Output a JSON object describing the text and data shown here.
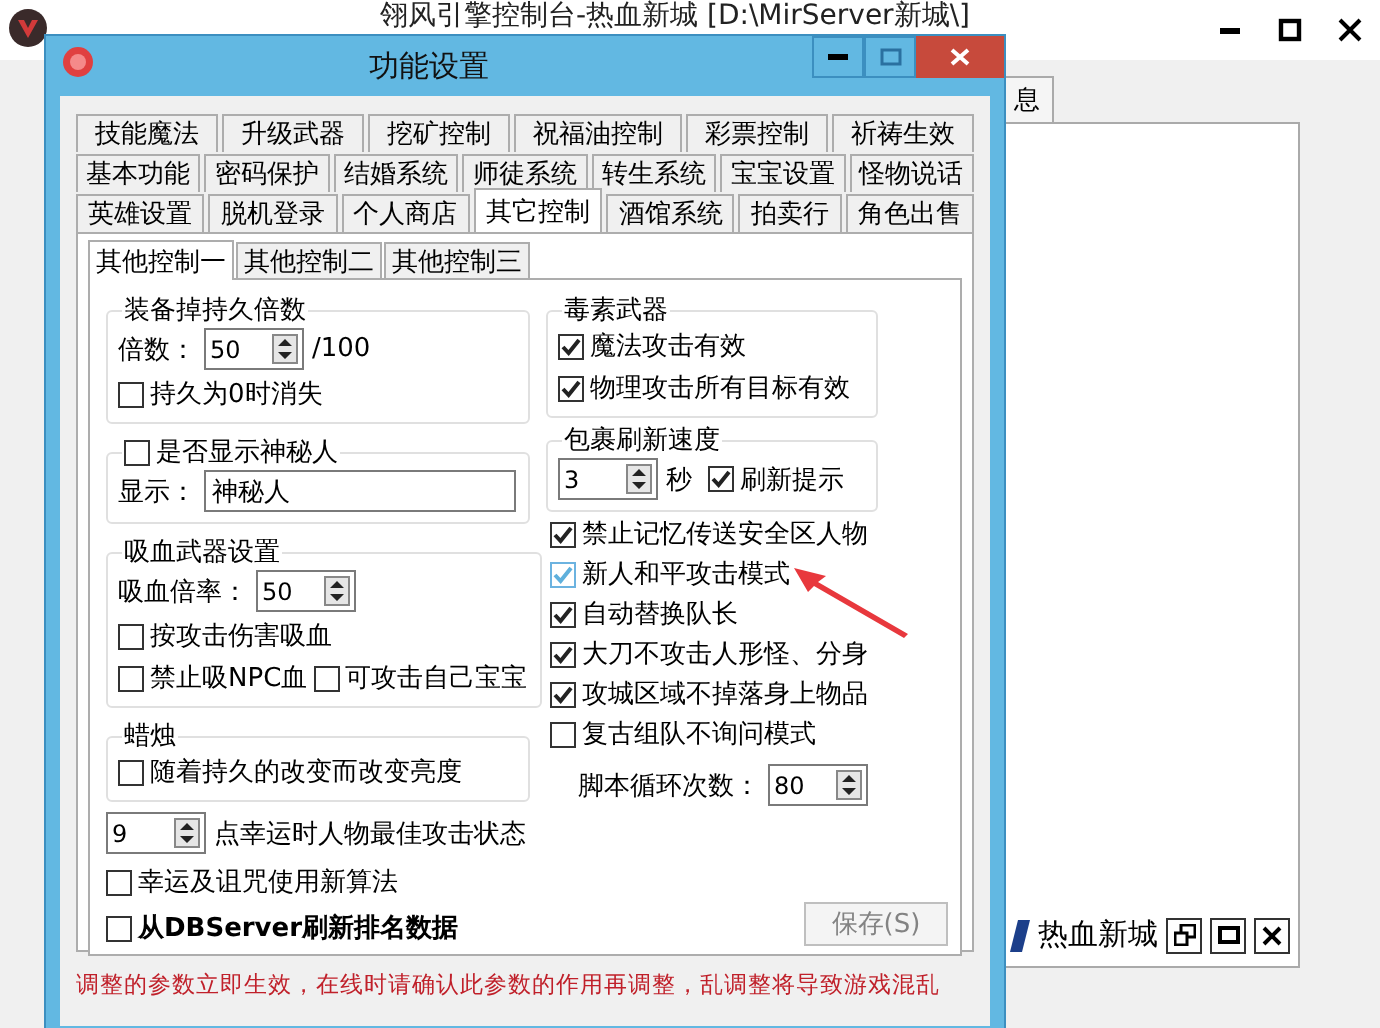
{
  "main_window": {
    "title": "翎风引擎控制台-热血新城 [D:\\MirServer新城\\]",
    "tab_label": "息",
    "mdi_child": {
      "title": "热血新城"
    }
  },
  "dialog": {
    "title": "功能设置",
    "tab_rows": [
      [
        {
          "label": "技能魔法",
          "selected": false
        },
        {
          "label": "升级武器",
          "selected": false
        },
        {
          "label": "挖矿控制",
          "selected": false
        },
        {
          "label": "祝福油控制",
          "selected": false
        },
        {
          "label": "彩票控制",
          "selected": false
        },
        {
          "label": "祈祷生效",
          "selected": false
        }
      ],
      [
        {
          "label": "基本功能",
          "selected": false
        },
        {
          "label": "密码保护",
          "selected": false
        },
        {
          "label": "结婚系统",
          "selected": false
        },
        {
          "label": "师徒系统",
          "selected": false
        },
        {
          "label": "转生系统",
          "selected": false
        },
        {
          "label": "宝宝设置",
          "selected": false
        },
        {
          "label": "怪物说话",
          "selected": false
        }
      ],
      [
        {
          "label": "英雄设置",
          "selected": false
        },
        {
          "label": "脱机登录",
          "selected": false
        },
        {
          "label": "个人商店",
          "selected": false
        },
        {
          "label": "其它控制",
          "selected": true
        },
        {
          "label": "酒馆系统",
          "selected": false
        },
        {
          "label": "拍卖行",
          "selected": false
        },
        {
          "label": "角色出售",
          "selected": false
        }
      ]
    ],
    "subtabs": [
      {
        "label": "其他控制一",
        "selected": true
      },
      {
        "label": "其他控制二",
        "selected": false
      },
      {
        "label": "其他控制三",
        "selected": false
      }
    ],
    "left": [
      {
        "kind": "group",
        "title": "装备掉持久倍数",
        "items": [
          {
            "kind": "spin",
            "label": "倍数：",
            "value": "50",
            "suffix": "/100"
          },
          {
            "kind": "checkbox",
            "label": "持久为0时消失",
            "checked": false
          }
        ]
      },
      {
        "kind": "group",
        "title_checkbox": {
          "label": "是否显示神秘人",
          "checked": false
        },
        "items": [
          {
            "kind": "text_field",
            "label": "显示：",
            "value": "神秘人"
          }
        ]
      },
      {
        "kind": "group",
        "title": "吸血武器设置",
        "items": [
          {
            "kind": "spin",
            "label": "吸血倍率：",
            "value": "50"
          },
          {
            "kind": "checkbox",
            "label": "按攻击伤害吸血",
            "checked": false
          },
          {
            "kind": "row",
            "items": [
              {
                "kind": "checkbox",
                "label": "禁止吸NPC血",
                "checked": false
              },
              {
                "kind": "checkbox",
                "label": "可攻击自己宝宝",
                "checked": false
              }
            ]
          }
        ]
      },
      {
        "kind": "group",
        "title": "蜡烛",
        "items": [
          {
            "kind": "checkbox",
            "label": "随着持久的改变而改变亮度",
            "checked": false
          }
        ]
      },
      {
        "kind": "spin",
        "value": "9",
        "suffix": "点幸运时人物最佳攻击状态"
      },
      {
        "kind": "checkbox",
        "label": "幸运及诅咒使用新算法",
        "checked": false
      },
      {
        "kind": "checkbox",
        "label": "从DBServer刷新排名数据",
        "checked": false,
        "bold": true
      }
    ],
    "right": [
      {
        "kind": "group",
        "title": "毒素武器",
        "items": [
          {
            "kind": "checkbox",
            "label": "魔法攻击有效",
            "checked": true
          },
          {
            "kind": "checkbox",
            "label": "物理攻击所有目标有效",
            "checked": true
          }
        ]
      },
      {
        "kind": "group",
        "title": "包裹刷新速度",
        "items": [
          {
            "kind": "row",
            "items": [
              {
                "kind": "spin",
                "value": "3",
                "suffix": "秒"
              },
              {
                "kind": "checkbox",
                "label": "刷新提示",
                "checked": true
              }
            ]
          }
        ]
      },
      {
        "kind": "checkbox",
        "label": "禁止记忆传送安全区人物",
        "checked": true,
        "hovered": false
      },
      {
        "kind": "checkbox",
        "label": "新人和平攻击模式",
        "checked": true,
        "hovered": true
      },
      {
        "kind": "checkbox",
        "label": "自动替换队长",
        "checked": true,
        "hovered": false
      },
      {
        "kind": "checkbox",
        "label": "大刀不攻击人形怪、分身",
        "checked": true,
        "hovered": false
      },
      {
        "kind": "checkbox",
        "label": "攻城区域不掉落身上物品",
        "checked": true,
        "hovered": false
      },
      {
        "kind": "checkbox",
        "label": "复古组队不询问模式",
        "checked": false,
        "hovered": false
      },
      {
        "kind": "spin",
        "label": "脚本循环次数：",
        "value": "80"
      }
    ],
    "save_button": {
      "label": "保存(S)",
      "disabled": true
    },
    "notice": "调整的参数立即生效，在线时请确认此参数的作用再调整，乱调整将导致游戏混乱"
  }
}
